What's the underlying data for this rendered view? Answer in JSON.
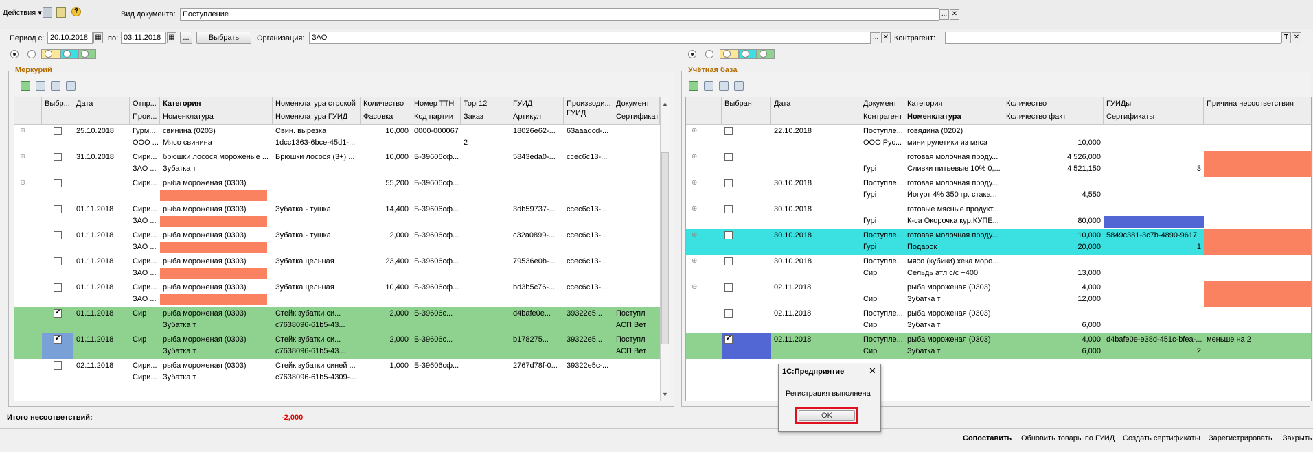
{
  "toolbar": {
    "actions_label": "Действия",
    "help_glyph": "?",
    "doc_type_label": "Вид документа:",
    "doc_type_value": "Поступление"
  },
  "filters": {
    "period_from_label": "Период с:",
    "period_from_value": "20.10.2018",
    "period_to_label": "по:",
    "period_to_value": "03.11.2018",
    "dots": "...",
    "select_label": "Выбрать",
    "org_label": "Организация:",
    "org_value": "ЗАО",
    "counterparty_label": "Контрагент:",
    "counterparty_value": ""
  },
  "left": {
    "title": "Меркурий",
    "headers_top": [
      "Выбр...",
      "Дата",
      "Отпр...",
      "Категория",
      "Номенклатура строкой",
      "Количество",
      "Номер ТТН",
      "Торг12",
      "ГУИД",
      "Производи...",
      "Документ"
    ],
    "headers_bottom": [
      "Прои...",
      "Номенклатура",
      "Номенклатура ГУИД",
      "Фасовка",
      "Код партии",
      "Заказ",
      "Артикул",
      "ГУИД",
      "Сертификат"
    ],
    "rows": [
      {
        "date": "25.10.2018",
        "c1": "Гурм...",
        "c2": "свинина (0203)",
        "c3": "Свин. вырезка",
        "c4": "10,000",
        "c5": "0000-000067",
        "c6": "",
        "c7": "18026e62-...",
        "c8": "63aaadcd-...",
        "c9": "",
        "s1": "ООО ...",
        "s2": "Мясо свинина",
        "s3": "1dcc1363-6bce-45d1-...",
        "s4": "",
        "s5": "",
        "s6": "2",
        "s7": "",
        "s8": "",
        "s9": ""
      },
      {
        "date": "31.10.2018",
        "c1": "Сири...",
        "c2": "брюшки лосося мороженые ...",
        "c3": "Брюшки лосося (3+) ...",
        "c4": "10,000",
        "c5": "Б-39606сф...",
        "c6": "",
        "c7": "5843eda0-...",
        "c8": "ccec6c13-...",
        "c9": "",
        "s1": "ЗАО ...",
        "s2": "Зубатка т",
        "s3": "",
        "s4": "",
        "s5": "",
        "s6": "",
        "s7": "",
        "s8": "",
        "s9": ""
      },
      {
        "date": "",
        "c1": "Сири...",
        "c2": "рыба мороженая (0303)",
        "c3": "",
        "c4": "55,200",
        "c5": "Б-39606сф...",
        "c6": "",
        "c7": "",
        "c8": "",
        "c9": "",
        "s1": "",
        "s2": "",
        "s3": "",
        "s4": "",
        "s5": "",
        "s6": "",
        "s7": "",
        "s8": "",
        "s9": ""
      },
      {
        "date": "01.11.2018",
        "c1": "Сири...",
        "c2": "рыба мороженая (0303)",
        "c3": "Зубатка - тушка",
        "c4": "14,400",
        "c5": "Б-39606сф...",
        "c6": "",
        "c7": "3db59737-...",
        "c8": "ccec6c13-...",
        "c9": "",
        "s1": "ЗАО ...",
        "s2": "",
        "s3": "",
        "s4": "",
        "s5": "",
        "s6": "",
        "s7": "",
        "s8": "",
        "s9": ""
      },
      {
        "date": "01.11.2018",
        "c1": "Сири...",
        "c2": "рыба мороженая (0303)",
        "c3": "Зубатка - тушка",
        "c4": "2,000",
        "c5": "Б-39606сф...",
        "c6": "",
        "c7": "c32a0899-...",
        "c8": "ccec6c13-...",
        "c9": "",
        "s1": "ЗАО ...",
        "s2": "",
        "s3": "",
        "s4": "",
        "s5": "",
        "s6": "",
        "s7": "",
        "s8": "",
        "s9": ""
      },
      {
        "date": "01.11.2018",
        "c1": "Сири...",
        "c2": "рыба мороженая (0303)",
        "c3": "Зубатка цельная",
        "c4": "23,400",
        "c5": "Б-39606сф...",
        "c6": "",
        "c7": "79536e0b-...",
        "c8": "ccec6c13-...",
        "c9": "",
        "s1": "ЗАО ...",
        "s2": "",
        "s3": "",
        "s4": "",
        "s5": "",
        "s6": "",
        "s7": "",
        "s8": "",
        "s9": ""
      },
      {
        "date": "01.11.2018",
        "c1": "Сири...",
        "c2": "рыба мороженая (0303)",
        "c3": "Зубатка цельная",
        "c4": "10,400",
        "c5": "Б-39606сф...",
        "c6": "",
        "c7": "bd3b5c76-...",
        "c8": "ccec6c13-...",
        "c9": "",
        "s1": "ЗАО ...",
        "s2": "",
        "s3": "",
        "s4": "",
        "s5": "",
        "s6": "",
        "s7": "",
        "s8": "",
        "s9": ""
      },
      {
        "date": "01.11.2018",
        "c1": "Сир",
        "c2": "рыба мороженая (0303)",
        "c3": "Стейк зубатки си...",
        "c4": "2,000",
        "c5": "Б-39606с...",
        "c6": "",
        "c7": "d4bafe0e...",
        "c8": "39322e5...",
        "c9": "Поступл",
        "s1": "",
        "s2": "Зубатка т",
        "s3": "c7638096-61b5-43...",
        "s4": "",
        "s5": "",
        "s6": "",
        "s7": "",
        "s8": "",
        "s9": "АСП Вет"
      },
      {
        "date": "01.11.2018",
        "c1": "Сир",
        "c2": "рыба мороженая (0303)",
        "c3": "Стейк зубатки си...",
        "c4": "2,000",
        "c5": "Б-39606с...",
        "c6": "",
        "c7": "b178275...",
        "c8": "39322e5...",
        "c9": "Поступл",
        "s1": "",
        "s2": "Зубатка т",
        "s3": "c7638096-61b5-43...",
        "s4": "",
        "s5": "",
        "s6": "",
        "s7": "",
        "s8": "",
        "s9": "АСП Вет"
      },
      {
        "date": "02.11.2018",
        "c1": "Сири...",
        "c2": "рыба мороженая (0303)",
        "c3": "Стейк зубатки синей ...",
        "c4": "1,000",
        "c5": "Б-39606сф...",
        "c6": "",
        "c7": "2767d78f-0...",
        "c8": "39322e5c-...",
        "c9": "",
        "s1": "Сири...",
        "s2": "Зубатка т",
        "s3": "c7638096-61b5-4309-...",
        "s4": "",
        "s5": "",
        "s6": "",
        "s7": "",
        "s8": "",
        "s9": ""
      }
    ]
  },
  "right": {
    "title": "Учётная база",
    "headers_top": [
      "Выбран",
      "Дата",
      "Документ",
      "Категория",
      "Количество",
      "ГУИДы",
      "Причина несоответствия"
    ],
    "headers_bottom": [
      "Контрагент",
      "Номенклатура",
      "Количество факт",
      "Сертификаты"
    ],
    "rows": [
      {
        "date": "22.10.2018",
        "doc": "Поступле...",
        "cat": "говядина (0202)",
        "qty": "",
        "guid": "",
        "reason": "",
        "kontr": "ООО Рус...",
        "nom": "мини рулетики из мяса",
        "fact": "10,000",
        "cert": ""
      },
      {
        "date": "",
        "doc": "",
        "cat": "готовая молочная проду...",
        "qty": "4 526,000",
        "guid": "",
        "reason": "",
        "kontr": "Гурі",
        "nom": "Сливки питьевые 10% 0,...",
        "fact": "4 521,150",
        "cert": "3"
      },
      {
        "date": "30.10.2018",
        "doc": "Поступле...",
        "cat": "готовая молочная проду...",
        "qty": "",
        "guid": "",
        "reason": "",
        "kontr": "Гурі",
        "nom": "Йогурт  4% 350 гр. стака...",
        "fact": "4,550",
        "cert": ""
      },
      {
        "date": "30.10.2018",
        "doc": "",
        "cat": "готовые мясные продукт...",
        "qty": "",
        "guid": "",
        "reason": "",
        "kontr": "Гурі",
        "nom": "К-са Окорочка кур.КУПЕ...",
        "fact": "80,000",
        "cert": ""
      },
      {
        "date": "30.10.2018",
        "doc": "Поступле...",
        "cat": "готовая молочная проду...",
        "qty": "10,000",
        "guid": "5849c381-3c7b-4890-9617...",
        "reason": "",
        "kontr": "Гурі",
        "nom": "Подарок",
        "fact": "20,000",
        "cert": "1"
      },
      {
        "date": "30.10.2018",
        "doc": "Поступле...",
        "cat": "мясо (кубики) хека моро...",
        "qty": "",
        "guid": "",
        "reason": "",
        "kontr": "Сир",
        "nom": "Сельдь атл с/с +400",
        "fact": "13,000",
        "cert": ""
      },
      {
        "date": "02.11.2018",
        "doc": "",
        "cat": "рыба мороженая (0303)",
        "qty": "4,000",
        "guid": "",
        "reason": "",
        "kontr": "Сир",
        "nom": "Зубатка т",
        "fact": "12,000",
        "cert": ""
      },
      {
        "date": "02.11.2018",
        "doc": "Поступле...",
        "cat": "рыба мороженая (0303)",
        "qty": "",
        "guid": "",
        "reason": "",
        "kontr": "Сир",
        "nom": "Зубатка т",
        "fact": "6,000",
        "cert": ""
      },
      {
        "date": "02.11.2018",
        "doc": "Поступле...",
        "cat": "рыба мороженая (0303)",
        "qty": "4,000",
        "guid": "d4bafe0e-e38d-451c-bfea-...",
        "reason": "меньше на 2",
        "kontr": "Сир",
        "nom": "Зубатка т",
        "fact": "6,000",
        "cert": "2"
      }
    ]
  },
  "summary": {
    "label": "Итого несоответствий:",
    "value": "-2,000"
  },
  "bottom": {
    "compare": "Сопоставить",
    "update_goods": "Обновить товары по ГУИД",
    "create_certs": "Создать сертификаты",
    "register": "Зарегистрировать",
    "close": "Закрыть"
  },
  "dialog": {
    "title": "1С:Предприятие",
    "close_glyph": "✕",
    "message": "Регистрация выполнена",
    "ok": "OK"
  },
  "colors": {
    "green_row": "#8fd18f",
    "cyan_row": "#3be0e0",
    "orange": "#fa8260",
    "blue": "#5267d4",
    "title_color": "#b36b00"
  }
}
